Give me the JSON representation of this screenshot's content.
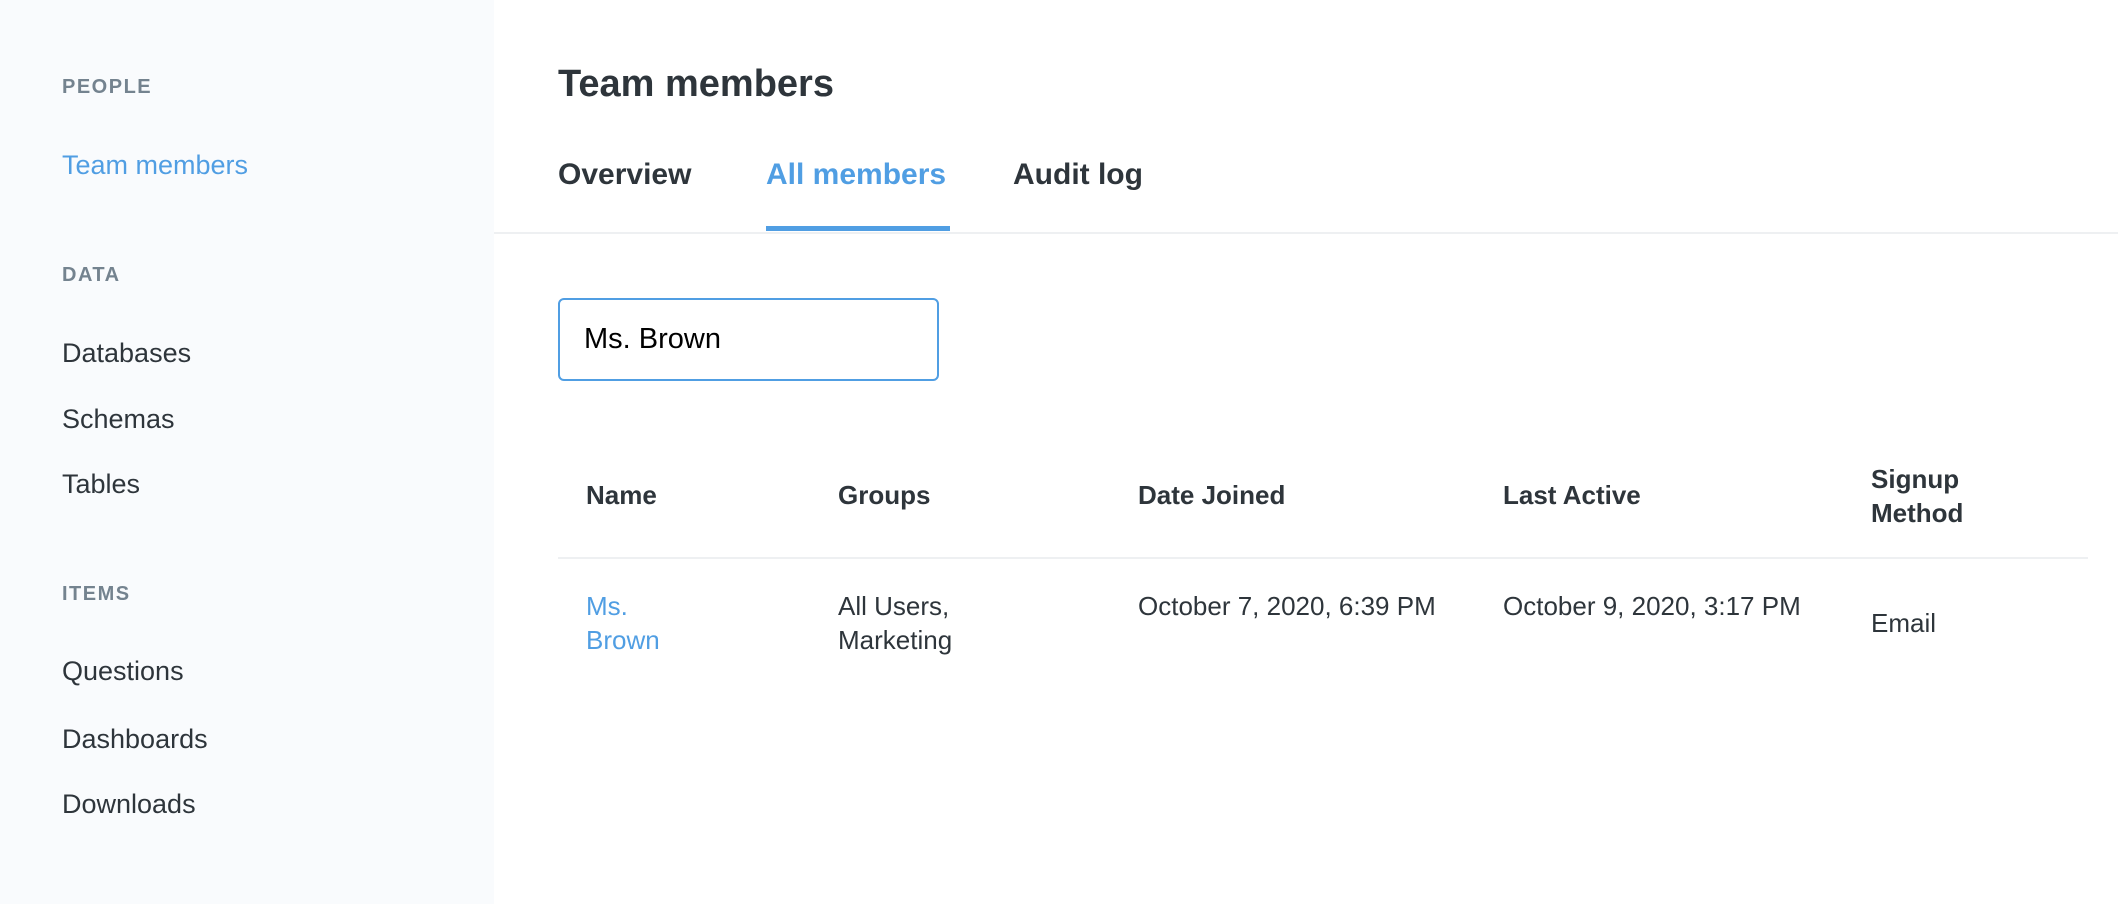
{
  "sidebar": {
    "sections": [
      {
        "heading": "PEOPLE",
        "items": [
          {
            "label": "Team members",
            "active": true
          }
        ]
      },
      {
        "heading": "DATA",
        "items": [
          {
            "label": "Databases"
          },
          {
            "label": "Schemas"
          },
          {
            "label": "Tables"
          }
        ]
      },
      {
        "heading": "ITEMS",
        "items": [
          {
            "label": "Questions"
          },
          {
            "label": "Dashboards"
          },
          {
            "label": "Downloads"
          }
        ]
      }
    ]
  },
  "main": {
    "title": "Team members",
    "tabs": [
      {
        "label": "Overview"
      },
      {
        "label": "All members",
        "active": true
      },
      {
        "label": "Audit log"
      }
    ],
    "search": {
      "value": "Ms. Brown"
    },
    "table": {
      "headers": [
        "Name",
        "Groups",
        "Date Joined",
        "Last Active",
        "Signup Method"
      ],
      "rows": [
        {
          "name": "Ms. Brown",
          "groups": "All Users, Marketing",
          "date_joined": "October 7, 2020, 6:39 PM",
          "last_active": "October 9, 2020, 3:17 PM",
          "signup_method": "Email"
        }
      ]
    }
  },
  "colors": {
    "accent": "#509ee3",
    "text": "#2e353b",
    "muted": "#74838f",
    "sidebar_bg": "#f9fbfd"
  }
}
